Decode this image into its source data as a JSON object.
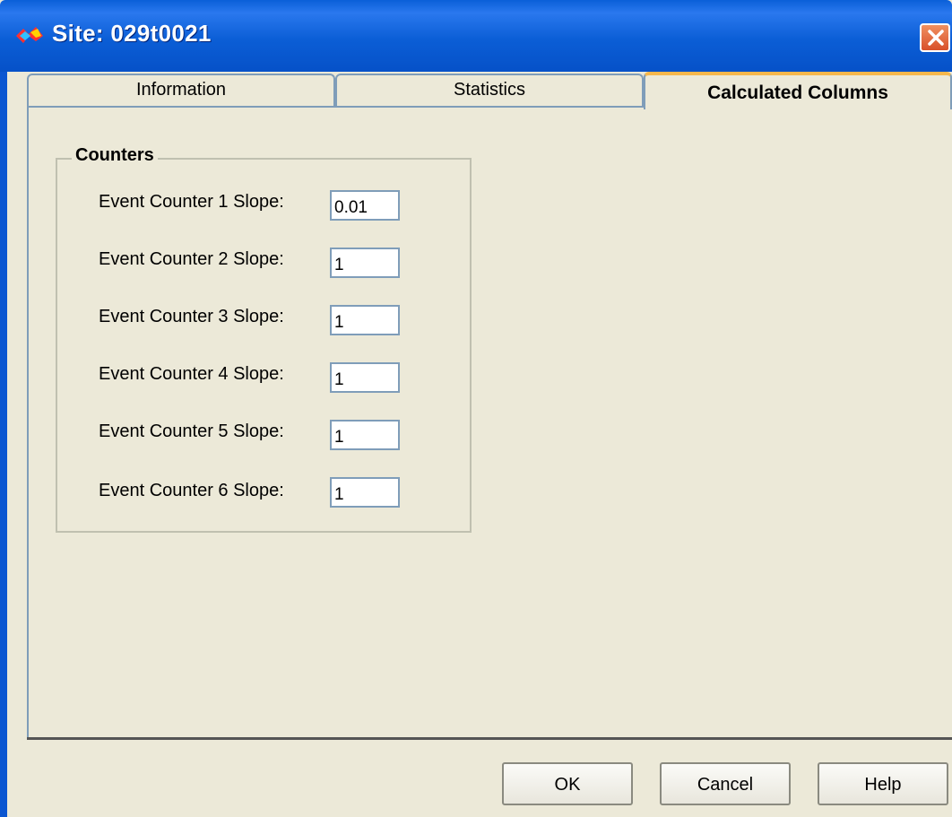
{
  "window": {
    "title": "Site: 029t0021",
    "close_icon": "close-icon",
    "app_icon": "site-app-icon"
  },
  "tabs": [
    {
      "label": "Information",
      "selected": false
    },
    {
      "label": "Statistics",
      "selected": false
    },
    {
      "label": "Calculated Columns",
      "selected": true
    }
  ],
  "counters": {
    "legend": "Counters",
    "rows": [
      {
        "label": "Event Counter 1 Slope:",
        "value": "0.01"
      },
      {
        "label": "Event Counter 2 Slope:",
        "value": "1"
      },
      {
        "label": "Event Counter 3 Slope:",
        "value": "1"
      },
      {
        "label": "Event Counter 4 Slope:",
        "value": "1"
      },
      {
        "label": "Event Counter 5 Slope:",
        "value": "1"
      },
      {
        "label": "Event Counter 6 Slope:",
        "value": "1"
      }
    ]
  },
  "buttons": {
    "ok": "OK",
    "cancel": "Cancel",
    "help": "Help"
  },
  "colors": {
    "title_bar": "#0a5fd8",
    "dialog_background": "#ece9d8",
    "selected_tab_highlight": "#f5b74c",
    "close_button": "#d8502a"
  }
}
